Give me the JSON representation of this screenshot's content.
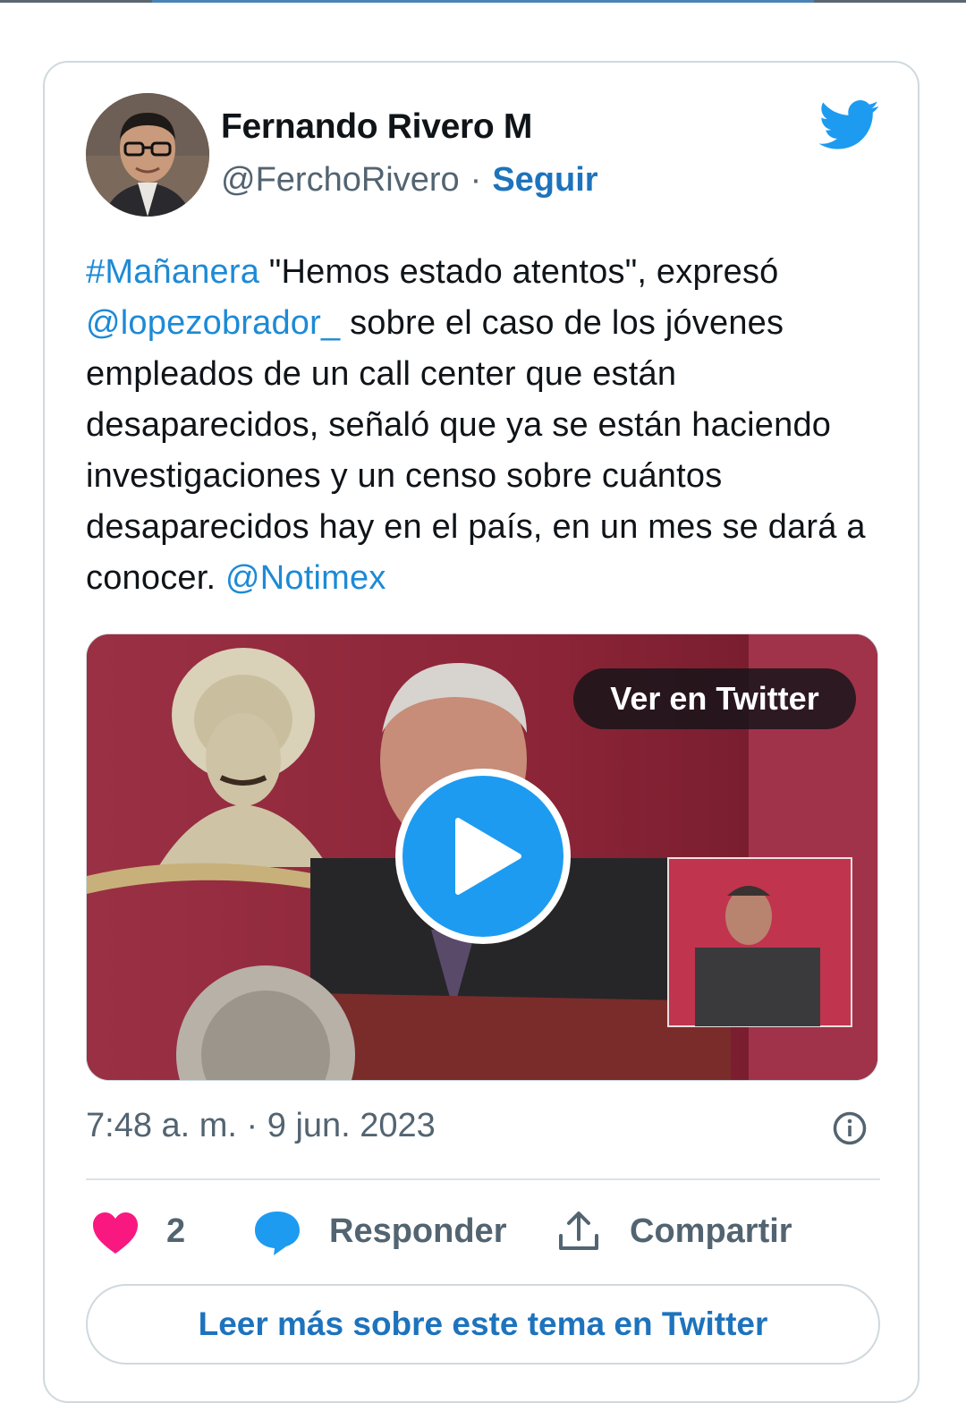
{
  "tweet": {
    "author": {
      "name": "Fernando Rivero M",
      "handle": "@FerchoRivero",
      "separator": "·",
      "follow_label": "Seguir"
    },
    "text": {
      "hashtag": "#Mañanera",
      "part1": " \"Hemos estado atentos\", expresó ",
      "mention1": "@lopezobrador_",
      "part2": " sobre el caso de los jóvenes empleados de un call center que están desaparecidos, señaló que ya se están haciendo investigaciones y un censo sobre cuántos desaparecidos hay en el país, en un mes se dará a conocer. ",
      "mention2": "@Notimex"
    },
    "media": {
      "view_on_twitter_label": "Ver en Twitter",
      "play_icon": "play-icon"
    },
    "timestamp": "7:48 a. m. · 9 jun. 2023",
    "actions": {
      "like_count": "2",
      "reply_label": "Responder",
      "share_label": "Compartir"
    },
    "read_more_label": "Leer más sobre este tema en Twitter"
  },
  "icons": {
    "brand": "twitter-bird-icon",
    "info": "info-icon",
    "like": "heart-icon",
    "reply": "speech-bubble-icon",
    "share": "upload-icon"
  },
  "colors": {
    "twitter_blue": "#1d9bf0",
    "link_blue": "#1d8ad6",
    "follow_blue": "#1d73bd",
    "like_pink": "#f91880",
    "secondary_text": "#536471",
    "border": "#cfd9de"
  }
}
